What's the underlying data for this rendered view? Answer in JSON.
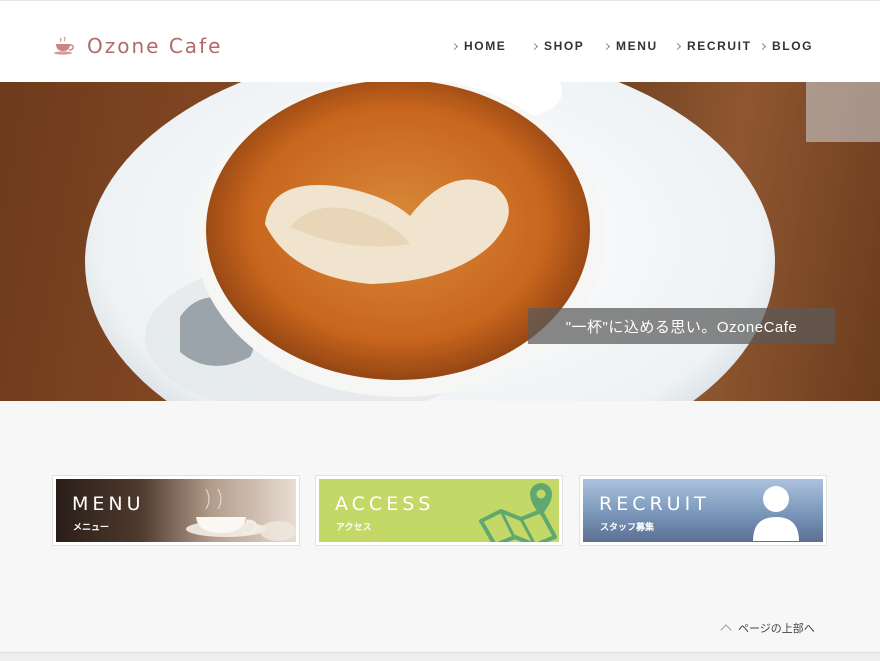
{
  "site": {
    "logo_text": "Ozone Cafe"
  },
  "nav": {
    "items": [
      {
        "label": "HOME"
      },
      {
        "label": "SHOP"
      },
      {
        "label": "MENU"
      },
      {
        "label": "RECRUIT"
      },
      {
        "label": "BLOG"
      }
    ]
  },
  "hero": {
    "tagline": "\"一杯\"に込める思い。OzoneCafe"
  },
  "banners": [
    {
      "title": "MENU",
      "subtitle": "メニュー"
    },
    {
      "title": "ACCESS",
      "subtitle": "アクセス"
    },
    {
      "title": "RECRUIT",
      "subtitle": "スタッフ募集"
    }
  ],
  "page_top": {
    "label": "ページの上部へ"
  }
}
